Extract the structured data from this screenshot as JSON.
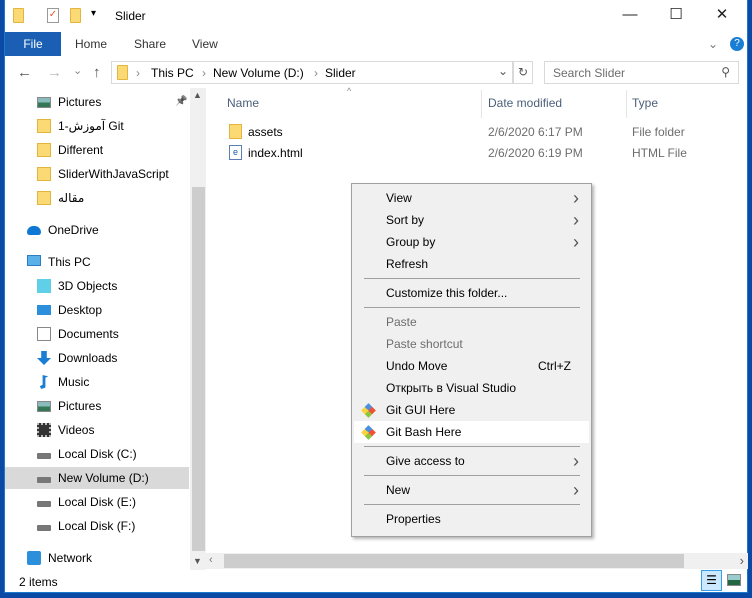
{
  "window": {
    "title": "Slider",
    "minimize": "—",
    "maximize": "☐",
    "close": "✕"
  },
  "ribbon": {
    "tabs": [
      "File",
      "Home",
      "Share",
      "View"
    ],
    "expand": "⌄",
    "help": "?"
  },
  "address": {
    "back": "←",
    "forward": "→",
    "recent": "⌄",
    "up": "↑",
    "crumbs": [
      "This PC",
      "New Volume (D:)",
      "Slider"
    ],
    "dropdown": "⌄",
    "refresh": "↻",
    "search_placeholder": "Search Slider",
    "search_icon": "search-icon"
  },
  "sidebar": {
    "items": [
      {
        "label": "Pictures",
        "icon": "pictures-icon",
        "pinned": true
      },
      {
        "label": "1-آموزش Git",
        "icon": "folder-icon"
      },
      {
        "label": "Different",
        "icon": "folder-icon"
      },
      {
        "label": "SliderWithJavaScript",
        "icon": "folder-icon"
      },
      {
        "label": "مقاله",
        "icon": "folder-icon"
      },
      {
        "label": "OneDrive",
        "icon": "onedrive-icon"
      },
      {
        "label": "This PC",
        "icon": "computer-icon"
      },
      {
        "label": "3D Objects",
        "icon": "cube-icon"
      },
      {
        "label": "Desktop",
        "icon": "desktop-icon"
      },
      {
        "label": "Documents",
        "icon": "documents-icon"
      },
      {
        "label": "Downloads",
        "icon": "download-icon"
      },
      {
        "label": "Music",
        "icon": "music-icon"
      },
      {
        "label": "Pictures",
        "icon": "pictures-icon"
      },
      {
        "label": "Videos",
        "icon": "videos-icon"
      },
      {
        "label": "Local Disk (C:)",
        "icon": "drive-icon"
      },
      {
        "label": "New Volume (D:)",
        "icon": "drive-icon",
        "selected": true
      },
      {
        "label": "Local Disk (E:)",
        "icon": "drive-icon"
      },
      {
        "label": "Local Disk (F:)",
        "icon": "drive-icon"
      },
      {
        "label": "Network",
        "icon": "network-icon"
      }
    ]
  },
  "files": {
    "columns": [
      "Name",
      "Date modified",
      "Type"
    ],
    "rows": [
      {
        "name": "assets",
        "date": "2/6/2020 6:17 PM",
        "type": "File folder",
        "icon": "folder-icon"
      },
      {
        "name": "index.html",
        "date": "2/6/2020 6:19 PM",
        "type": "HTML File",
        "icon": "html-file-icon"
      }
    ]
  },
  "context_menu": {
    "items": [
      {
        "label": "View",
        "submenu": true
      },
      {
        "label": "Sort by",
        "submenu": true
      },
      {
        "label": "Group by",
        "submenu": true
      },
      {
        "label": "Refresh"
      },
      {
        "sep": true
      },
      {
        "label": "Customize this folder..."
      },
      {
        "sep": true
      },
      {
        "label": "Paste",
        "disabled": true
      },
      {
        "label": "Paste shortcut",
        "disabled": true
      },
      {
        "label": "Undo Move",
        "shortcut": "Ctrl+Z"
      },
      {
        "label": "Открыть в Visual Studio"
      },
      {
        "label": "Git GUI Here",
        "icon": "git-icon"
      },
      {
        "label": "Git Bash Here",
        "icon": "git-icon",
        "highlighted": true
      },
      {
        "sep": true
      },
      {
        "label": "Give access to",
        "submenu": true
      },
      {
        "sep": true
      },
      {
        "label": "New",
        "submenu": true
      },
      {
        "sep": true
      },
      {
        "label": "Properties"
      }
    ]
  },
  "status": {
    "count": "2 items"
  },
  "colors": {
    "accent": "#1a5fb3",
    "selection": "#d9d9d9",
    "menu_bg": "#f0f0f0"
  }
}
